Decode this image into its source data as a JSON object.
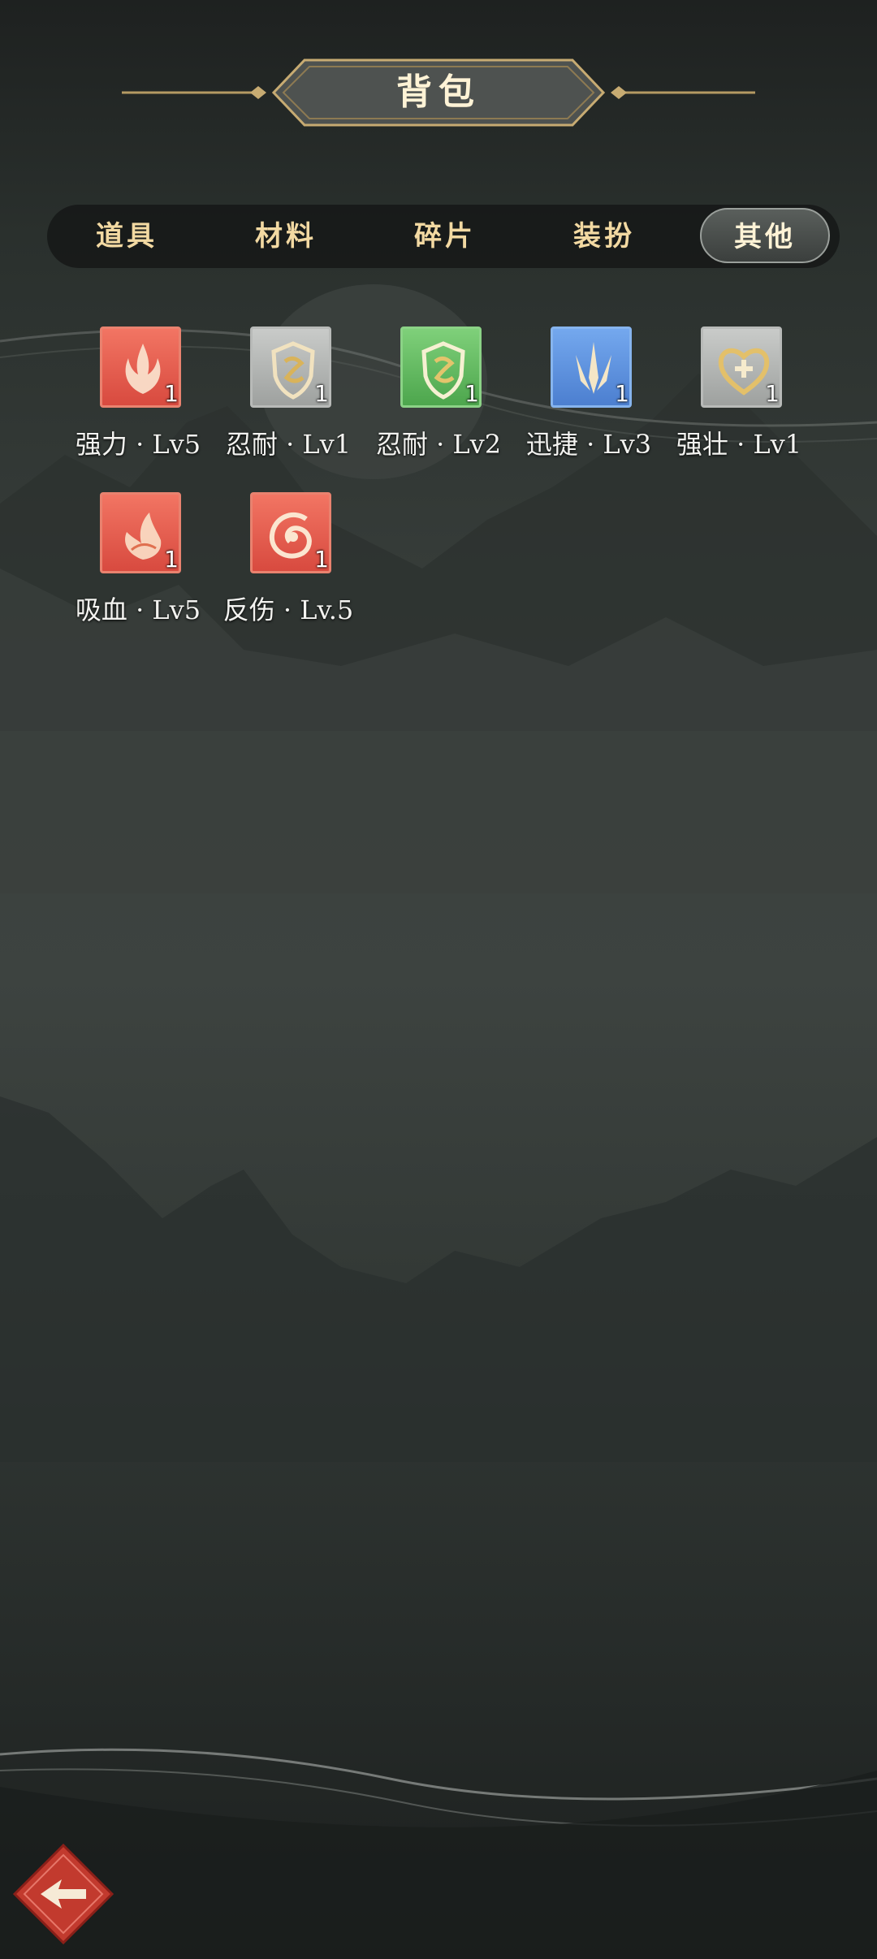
{
  "header": {
    "title": "背包"
  },
  "tabs": [
    {
      "label": "道具",
      "active": false
    },
    {
      "label": "材料",
      "active": false
    },
    {
      "label": "碎片",
      "active": false
    },
    {
      "label": "装扮",
      "active": false
    },
    {
      "label": "其他",
      "active": true
    }
  ],
  "items": [
    {
      "name": "强力 · Lv5",
      "qty": "1",
      "icon": "flame-claw-icon",
      "color": "#e85a4c"
    },
    {
      "name": "忍耐 · Lv1",
      "qty": "1",
      "icon": "shield-emblem-icon",
      "color": "#b2b4b2"
    },
    {
      "name": "忍耐 · Lv2",
      "qty": "1",
      "icon": "shield-emblem-icon",
      "color": "#5fba5c"
    },
    {
      "name": "迅捷 · Lv3",
      "qty": "1",
      "icon": "triple-spike-icon",
      "color": "#5d91df"
    },
    {
      "name": "强壮 · Lv1",
      "qty": "1",
      "icon": "heart-plus-icon",
      "color": "#b2b4b2"
    },
    {
      "name": "吸血 · Lv5",
      "qty": "1",
      "icon": "blood-leaf-icon",
      "color": "#e85a4c"
    },
    {
      "name": "反伤 · Lv.5",
      "qty": "1",
      "icon": "swirl-shield-icon",
      "color": "#e85a4c"
    }
  ],
  "back_button": {
    "icon": "back-arrow-icon"
  }
}
